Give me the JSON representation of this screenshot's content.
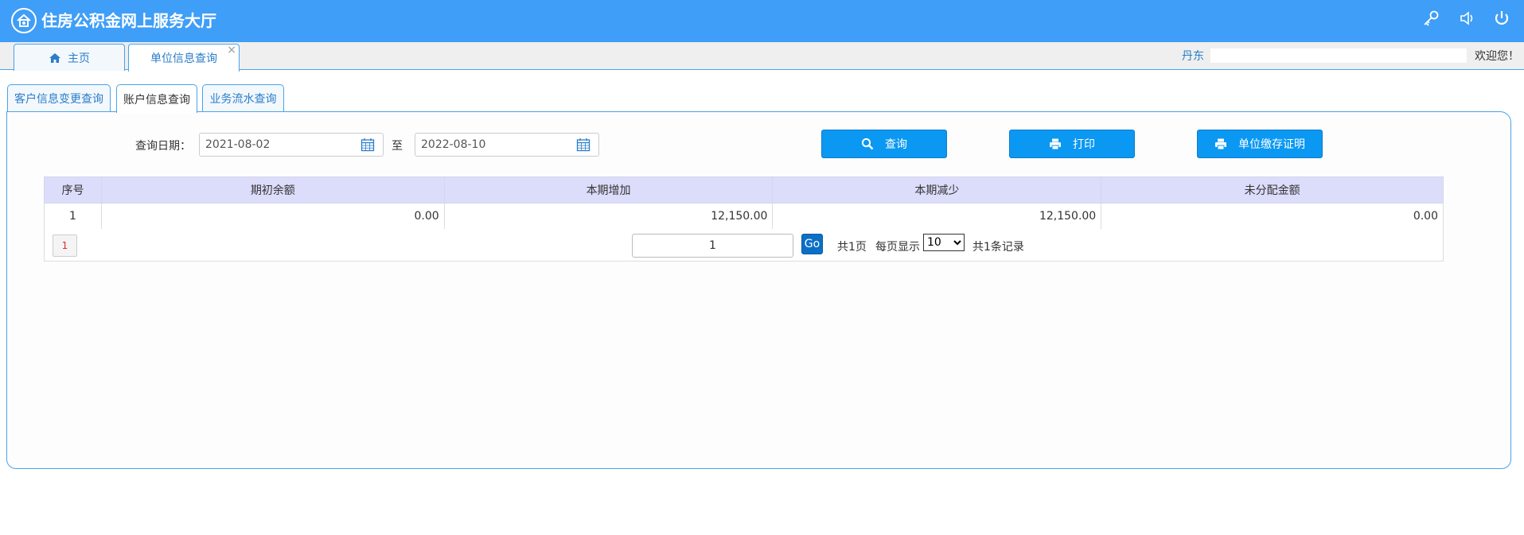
{
  "header": {
    "title": "住房公积金网上服务大厅",
    "icons": [
      "key-icon",
      "speaker-icon",
      "power-icon"
    ]
  },
  "top_tabs": [
    {
      "label": "主页",
      "icon": "home-icon"
    },
    {
      "label": "单位信息查询",
      "closable": true,
      "close": "×"
    }
  ],
  "user": {
    "name": "丹东",
    "welcome": "欢迎您！"
  },
  "sub_tabs": [
    {
      "label": "客户信息变更查询"
    },
    {
      "label": "账户信息查询",
      "active": true
    },
    {
      "label": "业务流水查询"
    }
  ],
  "query": {
    "date_label": "查询日期：",
    "start_date": "2021-08-02",
    "separator": "至",
    "end_date": "2022-08-10",
    "buttons": {
      "search": "查询",
      "print": "打印",
      "certificate": "单位缴存证明"
    }
  },
  "table": {
    "headers": [
      "序号",
      "期初余额",
      "本期增加",
      "本期减少",
      "未分配金额"
    ],
    "rows": [
      [
        "1",
        "0.00",
        "12,150.00",
        "12,150.00",
        "0.00"
      ]
    ]
  },
  "pager": {
    "current_page_button": "1",
    "page_input": "1",
    "go": "Go",
    "total_pages": "共1页",
    "per_page_label": "每页显示",
    "page_size": "10",
    "total_records": "共1条记录"
  },
  "colors": {
    "header_bg": "#3f9ef7",
    "button_bg": "#0a98f2",
    "table_header_bg": "#dcdcfb",
    "tab_border": "#4ba2e8"
  }
}
